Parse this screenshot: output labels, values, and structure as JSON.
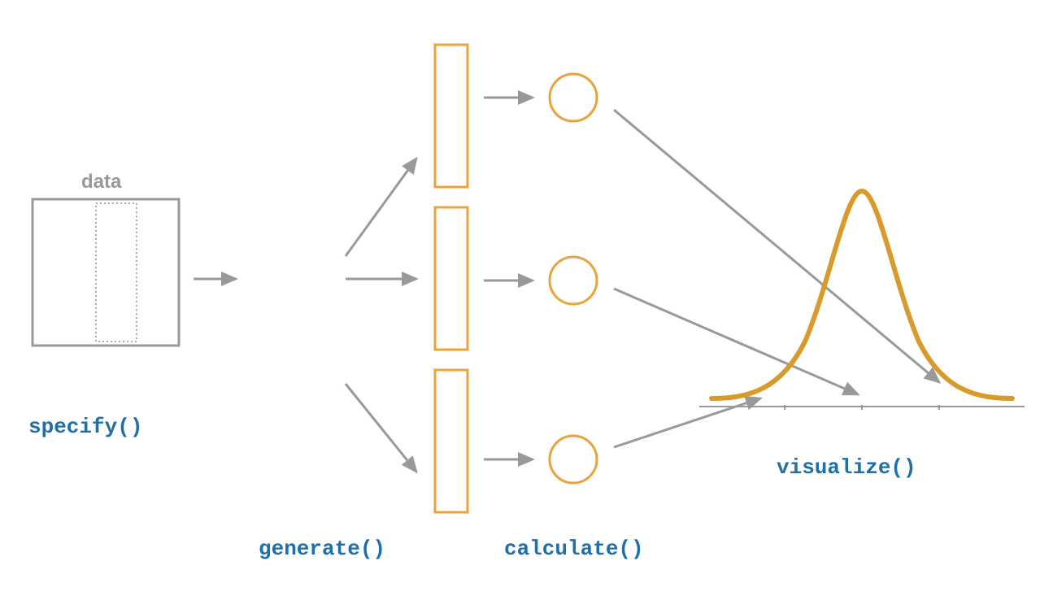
{
  "labels": {
    "data": "data",
    "specify": "specify()",
    "generate": "generate()",
    "calculate": "calculate()",
    "visualize": "visualize()"
  },
  "colors": {
    "grey": "#999999",
    "orange": "#e8a33d",
    "darkOrange": "#c98a1f",
    "blue": "#1f6fa8"
  },
  "diagram": {
    "description": "Pipeline diagram showing data flowing through specify, generate, calculate, visualize stages",
    "stages": [
      "specify",
      "generate",
      "calculate",
      "visualize"
    ]
  }
}
